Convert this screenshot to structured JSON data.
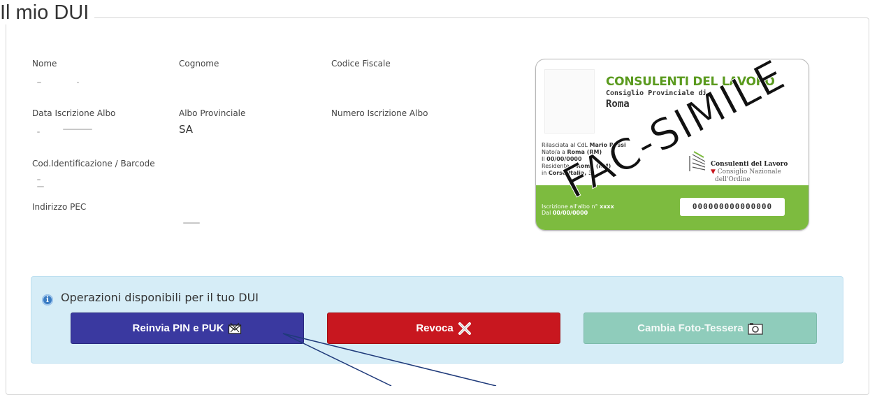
{
  "section_title": "Il mio DUI",
  "fields": {
    "nome_label": "Nome",
    "cognome_label": "Cognome",
    "codice_fiscale_label": "Codice Fiscale",
    "data_iscrizione_label": "Data Iscrizione Albo",
    "albo_provinciale_label": "Albo Provinciale",
    "albo_provinciale_value": "SA",
    "numero_iscrizione_label": "Numero Iscrizione Albo",
    "cod_identificazione_label": "Cod.Identificazione / Barcode",
    "pec_label": "Indirizzo PEC"
  },
  "card": {
    "title": "CONSULENTI DEL LAVORO",
    "subtitle": "Consiglio Provinciale di",
    "city": "Roma",
    "rilasciata_label": "Rilasciata al CdL",
    "rilasciata_name": "Mario Rossi",
    "nato_label": "Nato/a a",
    "nato_value": "Roma (RM)",
    "il_label": "Il",
    "il_value": "00/00/0000",
    "residente_label": "Residente a",
    "residente_value": "Roma (RM)",
    "in_label": "in",
    "in_value": "Corso Italia, 3",
    "iscrizione_label": "Iscrizione all'albo n°",
    "iscrizione_value": "xxxx",
    "dal_label": "Dal",
    "dal_value": "00/00/0000",
    "barcode_number": "000000000000000",
    "org_line1": "Consulenti del Lavoro",
    "org_line2": "Consiglio Nazionale",
    "org_line3": "dell'Ordine",
    "watermark": "FAC-SIMILE"
  },
  "operations": {
    "title": "Operazioni disponibili per il tuo DUI",
    "reinvia_label": "Reinvia PIN e PUK",
    "revoca_label": "Revoca",
    "cambia_foto_label": "Cambia Foto-Tessera"
  },
  "colors": {
    "reinvia_bg": "#3a39a0",
    "revoca_bg": "#c8171f",
    "cambia_foto_bg": "#8fccbb",
    "panel_bg": "#d6edf7",
    "card_green": "#7dbb3f"
  },
  "icons": {
    "info": "info-circle-icon",
    "envelope": "envelope-icon",
    "close": "close-x-icon",
    "camera": "camera-icon"
  }
}
